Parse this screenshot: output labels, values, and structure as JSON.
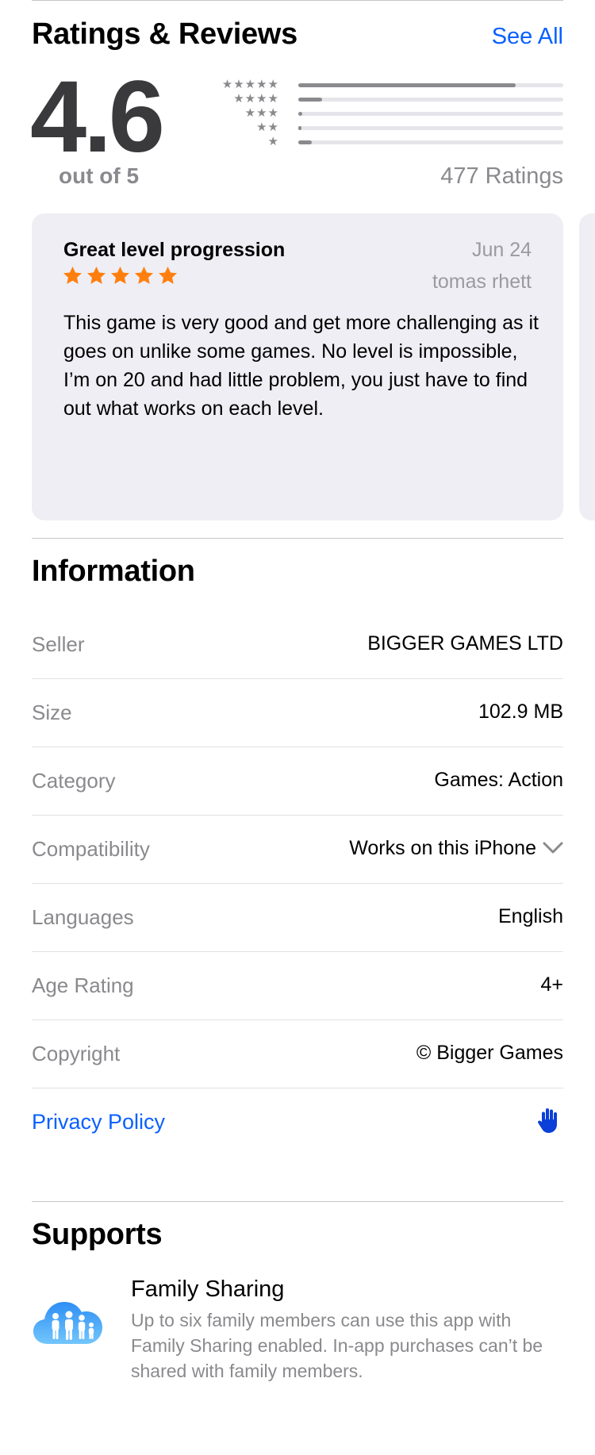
{
  "ratings": {
    "section_title": "Ratings & Reviews",
    "see_all_label": "See All",
    "average": "4.6",
    "out_of": "out of 5",
    "count_label": "477 Ratings",
    "distribution": [
      {
        "stars": 5,
        "fraction": 0.82
      },
      {
        "stars": 4,
        "fraction": 0.09
      },
      {
        "stars": 3,
        "fraction": 0.015
      },
      {
        "stars": 2,
        "fraction": 0.008
      },
      {
        "stars": 1,
        "fraction": 0.05
      }
    ]
  },
  "review": {
    "title": "Great level progression",
    "date": "Jun 24",
    "author": "tomas rhett",
    "rating": 5,
    "body": "This game is very good and get more challenging as it goes on unlike some games. No level is impossible, I’m on 20 and had little problem, you just have to find out what works on each level."
  },
  "information": {
    "section_title": "Information",
    "rows": [
      {
        "label": "Seller",
        "value": "BIGGER GAMES LTD"
      },
      {
        "label": "Size",
        "value": "102.9 MB"
      },
      {
        "label": "Category",
        "value": "Games: Action"
      },
      {
        "label": "Compatibility",
        "value": "Works on this iPhone"
      },
      {
        "label": "Languages",
        "value": "English"
      },
      {
        "label": "Age Rating",
        "value": "4+"
      },
      {
        "label": "Copyright",
        "value": "© Bigger Games"
      }
    ],
    "privacy_label": "Privacy Policy"
  },
  "supports": {
    "section_title": "Supports",
    "items": [
      {
        "title": "Family Sharing",
        "description": "Up to six family members can use this app with Family Sharing enabled. In-app purchases can’t be shared with family members.",
        "icon": "family-sharing-icon"
      }
    ]
  },
  "colors": {
    "accent": "#0a60ff",
    "star": "#ff7f0e",
    "secondary_text": "#8a8a8e",
    "card_bg": "#eeeef4"
  }
}
